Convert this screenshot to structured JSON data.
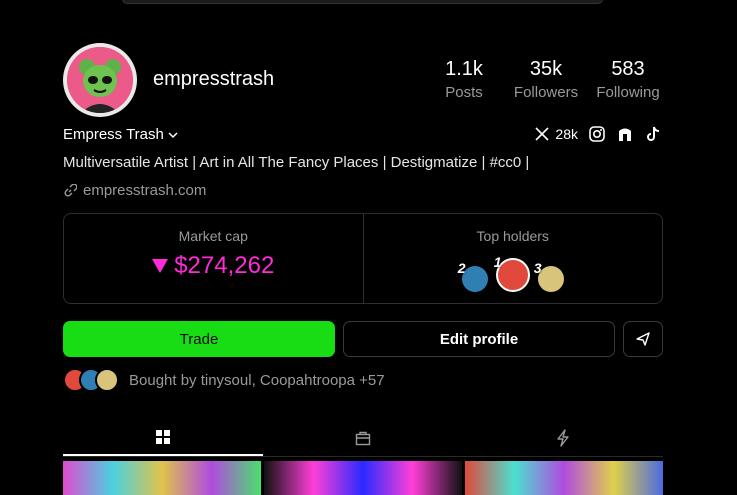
{
  "profile": {
    "username": "empresstrash",
    "display_name": "Empress Trash",
    "bio": "Multiversatile Artist | Art in All The Fancy Places | Destigmatize | #cc0 |",
    "website": "empresstrash.com",
    "stats": [
      {
        "value": "1.1k",
        "label": "Posts"
      },
      {
        "value": "35k",
        "label": "Followers"
      },
      {
        "value": "583",
        "label": "Following"
      }
    ],
    "x_followers": "28k"
  },
  "market": {
    "cap_label": "Market cap",
    "cap_value": "$274,262",
    "trend": "down",
    "accent": "#ff2bd6",
    "holders_label": "Top holders",
    "holders": [
      {
        "rank": "2",
        "color": "#2f7fb5"
      },
      {
        "rank": "1",
        "color": "#e0493b"
      },
      {
        "rank": "3",
        "color": "#d8c47a"
      }
    ]
  },
  "actions": {
    "trade_label": "Trade",
    "edit_label": "Edit profile",
    "trade_color": "#19dd14"
  },
  "bought": {
    "text": "Bought by tinysoul, Coopahtroopa +57"
  },
  "tabs": [
    {
      "icon": "grid-icon",
      "active": true
    },
    {
      "icon": "bag-icon",
      "active": false
    },
    {
      "icon": "lightning-icon",
      "active": false
    }
  ]
}
